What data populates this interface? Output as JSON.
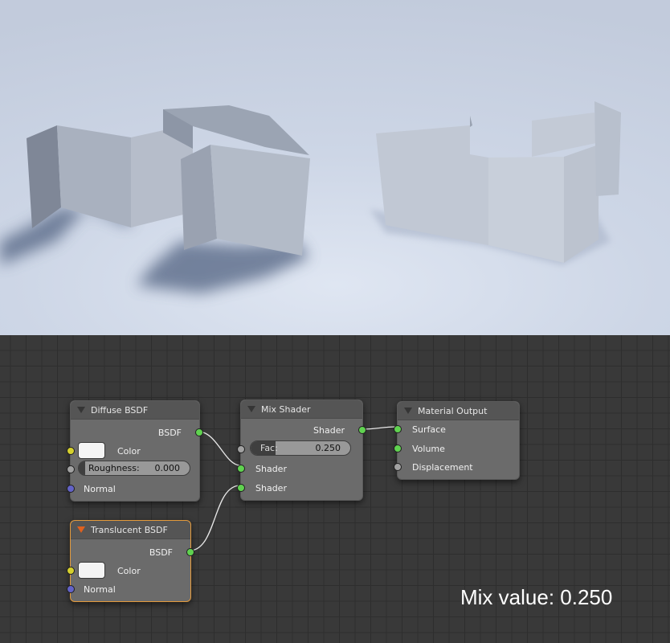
{
  "nodes": {
    "diffuse": {
      "title": "Diffuse BSDF",
      "output": "BSDF",
      "color_label": "Color",
      "roughness_label": "Roughness:",
      "roughness_value": "0.000",
      "normal_label": "Normal"
    },
    "mix": {
      "title": "Mix Shader",
      "output": "Shader",
      "fac_label": "Fac:",
      "fac_value": "0.250",
      "fac_fraction": 0.25,
      "shader1": "Shader",
      "shader2": "Shader"
    },
    "output": {
      "title": "Material Output",
      "surface": "Surface",
      "volume": "Volume",
      "displacement": "Displacement"
    },
    "translucent": {
      "title": "Translucent BSDF",
      "output": "BSDF",
      "color_label": "Color",
      "normal_label": "Normal"
    }
  },
  "caption": "Mix value: 0.250",
  "colors": {
    "shader_socket": "#60d250",
    "color_socket": "#d6d12e",
    "value_socket": "#a2a2a2",
    "vector_socket": "#6363c7",
    "active_outline": "#e39a3c",
    "grid_bg": "#393939"
  }
}
